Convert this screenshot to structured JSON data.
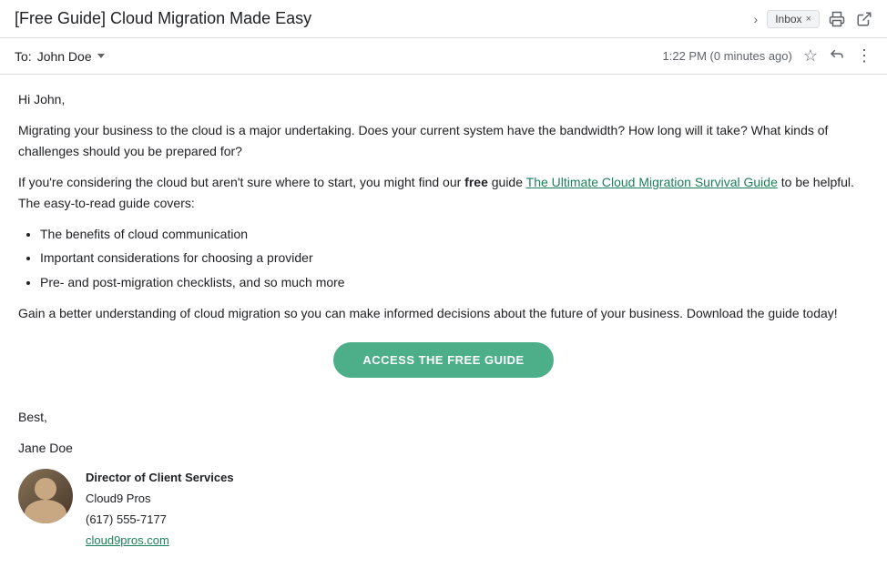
{
  "header": {
    "subject": "[Free Guide] Cloud Migration Made Easy",
    "label": "Inbox",
    "label_close": "×",
    "print_icon": "🖨",
    "open_icon": "⇗"
  },
  "sender_bar": {
    "to_label": "To:",
    "recipient": "John Doe",
    "timestamp": "1:22 PM (0 minutes ago)"
  },
  "body": {
    "greeting": "Hi John,",
    "paragraph1": "Migrating your business to the cloud is a major undertaking. Does your current system have the bandwidth? How long will it take? What kinds of challenges should you be prepared for?",
    "paragraph2_prefix": "If you're considering the cloud but aren't sure where to start, you might find our ",
    "bold_word": "free",
    "paragraph2_link": "The Ultimate Cloud Migration Survival Guide",
    "paragraph2_suffix": " to be helpful. The easy-to-read guide covers:",
    "bullet_1": "The benefits of cloud communication",
    "bullet_2": "Important considerations for choosing a provider",
    "bullet_3": "Pre- and post-migration checklists, and so much more",
    "paragraph3": "Gain a better understanding of cloud migration so you can make informed decisions about the future of your business. Download the guide today!",
    "cta_label": "ACCESS THE FREE GUIDE",
    "sign_off": "Best,",
    "sender_name": "Jane Doe",
    "sender_title": "Director of Client Services",
    "sender_company": "Cloud9 Pros",
    "sender_phone": "(617) 555-7177",
    "sender_website": "cloud9pros.com"
  },
  "icons": {
    "chevron_right": "›",
    "star": "☆",
    "reply": "↩",
    "more": "⋮",
    "print": "🖨",
    "popout": "⬡"
  }
}
